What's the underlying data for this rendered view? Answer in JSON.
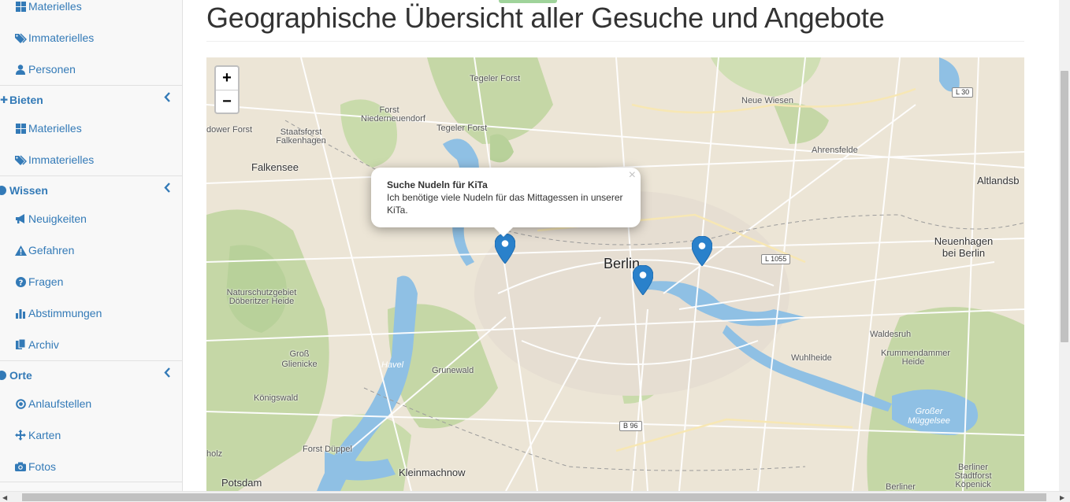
{
  "sidebar": {
    "items": [
      {
        "label": "Materielles",
        "icon": "grid-icon"
      },
      {
        "label": "Immaterielles",
        "icon": "tags-icon"
      },
      {
        "label": "Personen",
        "icon": "user-icon"
      }
    ],
    "sections": [
      {
        "label": "Bieten",
        "items": [
          {
            "label": "Materielles",
            "icon": "grid-icon"
          },
          {
            "label": "Immaterielles",
            "icon": "tags-icon"
          }
        ]
      },
      {
        "label": "Wissen",
        "items": [
          {
            "label": "Neuigkeiten",
            "icon": "bullhorn-icon"
          },
          {
            "label": "Gefahren",
            "icon": "warning-icon"
          },
          {
            "label": "Fragen",
            "icon": "question-icon"
          },
          {
            "label": "Abstimmungen",
            "icon": "bar-chart-icon"
          },
          {
            "label": "Archiv",
            "icon": "files-icon"
          }
        ]
      },
      {
        "label": "Orte",
        "items": [
          {
            "label": "Anlaufstellen",
            "icon": "dot-circle-icon"
          },
          {
            "label": "Karten",
            "icon": "move-icon"
          },
          {
            "label": "Fotos",
            "icon": "camera-icon"
          }
        ]
      }
    ]
  },
  "main": {
    "title": "Geographische Übersicht aller Gesuche und Angebote"
  },
  "map": {
    "zoom_in": "+",
    "zoom_out": "−",
    "popup": {
      "title": "Suche Nudeln für KiTa",
      "text": "Ich benötige viele Nudeln für das Mittagessen in unserer KiTa.",
      "close": "×"
    },
    "places": {
      "tegeler_forst_top": "Tegeler Forst",
      "forst_nieder": "Forst Niederneuendorf",
      "tegeler_forst": "Tegeler Forst",
      "staatsforst": "Staatsforst Falkenhagen",
      "dower_forst": "dower Forst",
      "falkensee": "Falkensee",
      "neue_wiesen": "Neue Wiesen",
      "ahrensfelde": "Ahrensfelde",
      "altlandsb": "Altlandsb",
      "neuenhagen": "Neuenhagen bei Berlin",
      "berlin": "Berlin",
      "naturschutz": "Naturschutzgebiet Döberitzer Heide",
      "gross_glienicke": "Groß Glienicke",
      "havel": "Havel",
      "grunewald": "Grunewald",
      "koenigswald": "Königswald",
      "waldesruh": "Waldesruh",
      "wuhlheide": "Wuhlheide",
      "krummendammer": "Krummendammer Heide",
      "grosser_mueggelsee": "Großer Müggelsee",
      "forst_dueppel": "Forst Düppel",
      "holz": "holz",
      "potsdam": "Potsdam",
      "kleinmachnow": "Kleinmachnow",
      "berliner_stadtforst": "Berliner Stadtforst Köpenick",
      "berliner": "Berliner"
    },
    "roads": {
      "l30": "L 30",
      "l1055": "L 1055",
      "b96": "B 96"
    }
  }
}
